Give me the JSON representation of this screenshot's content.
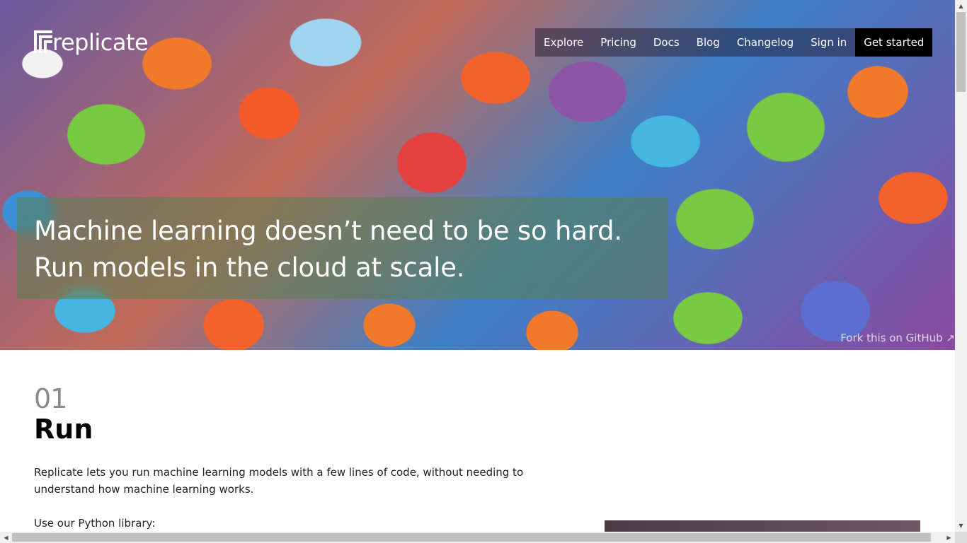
{
  "brand": {
    "name": "replicate"
  },
  "nav": {
    "items": [
      {
        "label": "Explore"
      },
      {
        "label": "Pricing"
      },
      {
        "label": "Docs"
      },
      {
        "label": "Blog"
      },
      {
        "label": "Changelog"
      },
      {
        "label": "Sign in"
      }
    ],
    "cta": "Get started"
  },
  "hero": {
    "line1": "Machine learning doesn’t need to be so hard.",
    "line2": "Run models in the cloud at scale.",
    "fork_link": "Fork this on GitHub ↗"
  },
  "section": {
    "number": "01",
    "title": "Run",
    "description": "Replicate lets you run machine learning models with a few lines of code, without needing to understand how machine learning works.",
    "library_label": "Use our Python library:"
  },
  "colors": {
    "cta_background": "#000000",
    "tagline_overlay": "#5a8250",
    "section_number": "#8a8a8a"
  }
}
